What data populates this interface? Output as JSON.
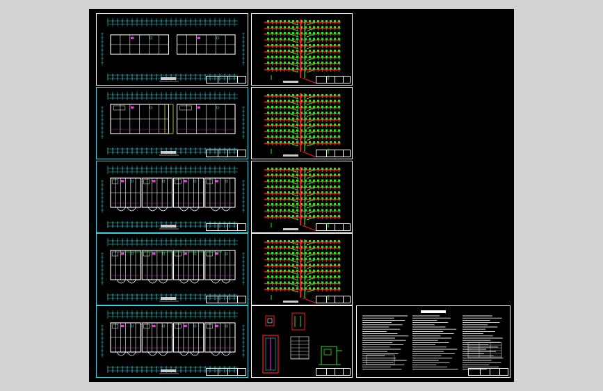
{
  "app": {
    "viewport_background": "#000000",
    "workspace_background": "#d2d2d2"
  },
  "colors": {
    "frame": "#ffffff",
    "wall": "#ffffff",
    "dimension": "#38d5e0",
    "pipe_red": "#ff1a1a",
    "pipe_green": "#33dd33",
    "accent_magenta": "#ff2bff",
    "accent_yellow": "#ffff33"
  },
  "sheets": {
    "floor_plans": [
      {
        "id": "plan-1",
        "kind": "floor-plan"
      },
      {
        "id": "plan-2",
        "kind": "floor-plan"
      },
      {
        "id": "plan-3",
        "kind": "floor-plan"
      },
      {
        "id": "plan-4",
        "kind": "floor-plan"
      },
      {
        "id": "plan-5",
        "kind": "floor-plan"
      }
    ],
    "risers": [
      {
        "id": "riser-1",
        "kind": "pipe-system"
      },
      {
        "id": "riser-2",
        "kind": "pipe-system"
      },
      {
        "id": "riser-3",
        "kind": "pipe-system"
      },
      {
        "id": "riser-4",
        "kind": "pipe-system"
      }
    ],
    "details": {
      "id": "details",
      "kind": "detail-drawings"
    },
    "notes": {
      "id": "design-notes",
      "kind": "notes-sheet"
    }
  }
}
